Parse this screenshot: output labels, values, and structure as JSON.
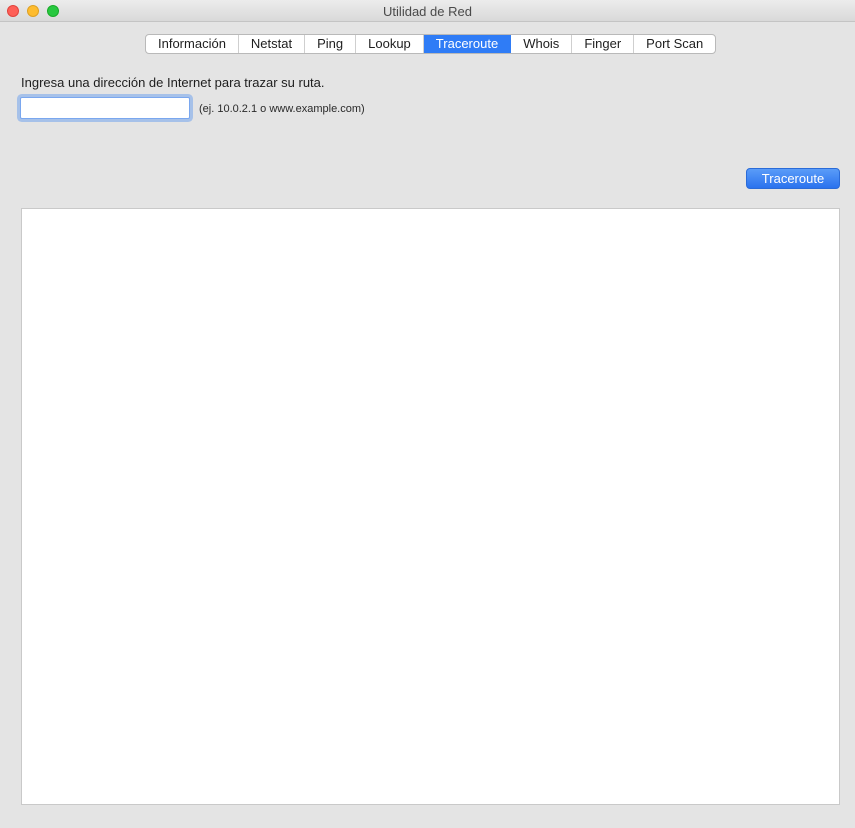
{
  "window": {
    "title": "Utilidad de Red"
  },
  "tabs": [
    {
      "label": "Información",
      "active": false
    },
    {
      "label": "Netstat",
      "active": false
    },
    {
      "label": "Ping",
      "active": false
    },
    {
      "label": "Lookup",
      "active": false
    },
    {
      "label": "Traceroute",
      "active": true
    },
    {
      "label": "Whois",
      "active": false
    },
    {
      "label": "Finger",
      "active": false
    },
    {
      "label": "Port Scan",
      "active": false
    }
  ],
  "traceroute": {
    "instruction": "Ingresa una dirección de Internet para trazar su ruta.",
    "address_value": "",
    "hint": "(ej. 10.0.2.1 o www.example.com)",
    "button_label": "Traceroute",
    "output": ""
  },
  "colors": {
    "accent": "#2f7cf6",
    "background": "#e4e4e4"
  }
}
